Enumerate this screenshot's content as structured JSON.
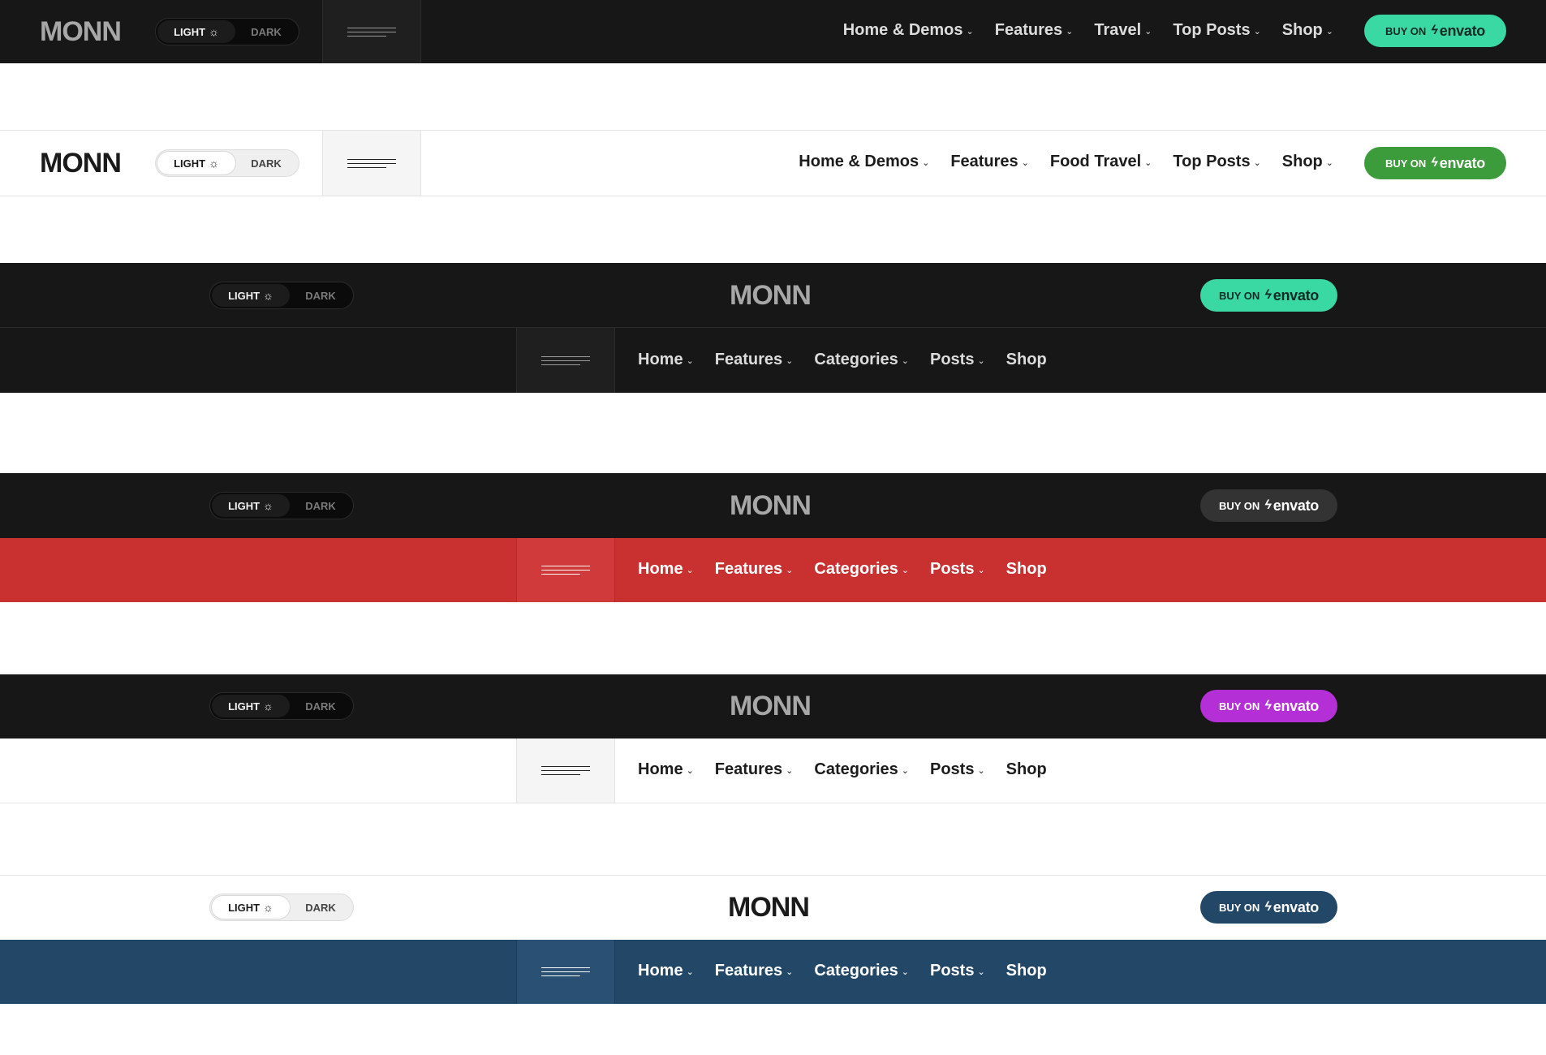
{
  "headers": {
    "h1": {
      "logo": "MONN",
      "toggle": {
        "light": "LIGHT",
        "dark": "DARK"
      },
      "nav": [
        "Home & Demos",
        "Features",
        "Travel",
        "Top Posts",
        "Shop"
      ],
      "buy": {
        "prefix": "BUY ON",
        "brand": "envato"
      },
      "colors": {
        "background": "#171717",
        "button": "#3ad9a4"
      }
    },
    "h2": {
      "logo": "MONN",
      "toggle": {
        "light": "LIGHT",
        "dark": "DARK"
      },
      "nav": [
        "Home & Demos",
        "Features",
        "Food Travel",
        "Top Posts",
        "Shop"
      ],
      "buy": {
        "prefix": "BUY ON",
        "brand": "envato"
      },
      "colors": {
        "background": "#ffffff",
        "button": "#3c9b3b"
      }
    },
    "h3": {
      "logo": "MONN",
      "toggle": {
        "light": "LIGHT",
        "dark": "DARK"
      },
      "nav": [
        "Home",
        "Features",
        "Categories",
        "Posts",
        "Shop"
      ],
      "buy": {
        "prefix": "BUY ON",
        "brand": "envato"
      },
      "colors": {
        "top": "#171717",
        "menu": "#171717",
        "button": "#3ad9a4"
      }
    },
    "h4": {
      "logo": "MONN",
      "toggle": {
        "light": "LIGHT",
        "dark": "DARK"
      },
      "nav": [
        "Home",
        "Features",
        "Categories",
        "Posts",
        "Shop"
      ],
      "buy": {
        "prefix": "BUY ON",
        "brand": "envato"
      },
      "colors": {
        "top": "#171717",
        "menu": "#c93030",
        "button": "#333333"
      }
    },
    "h5": {
      "logo": "MONN",
      "toggle": {
        "light": "LIGHT",
        "dark": "DARK"
      },
      "nav": [
        "Home",
        "Features",
        "Categories",
        "Posts",
        "Shop"
      ],
      "buy": {
        "prefix": "BUY ON",
        "brand": "envato"
      },
      "colors": {
        "top": "#171717",
        "menu": "#ffffff",
        "button": "#b52fd6"
      }
    },
    "h6": {
      "logo": "MONN",
      "toggle": {
        "light": "LIGHT",
        "dark": "DARK"
      },
      "nav": [
        "Home",
        "Features",
        "Categories",
        "Posts",
        "Shop"
      ],
      "buy": {
        "prefix": "BUY ON",
        "brand": "envato"
      },
      "colors": {
        "top": "#ffffff",
        "menu": "#234766",
        "button": "#234766"
      }
    }
  },
  "icons": {
    "sun": "sun-icon",
    "chevron": "chevron-down-icon",
    "menu": "hamburger-menu-icon",
    "bolt": "envato-bolt-icon"
  }
}
